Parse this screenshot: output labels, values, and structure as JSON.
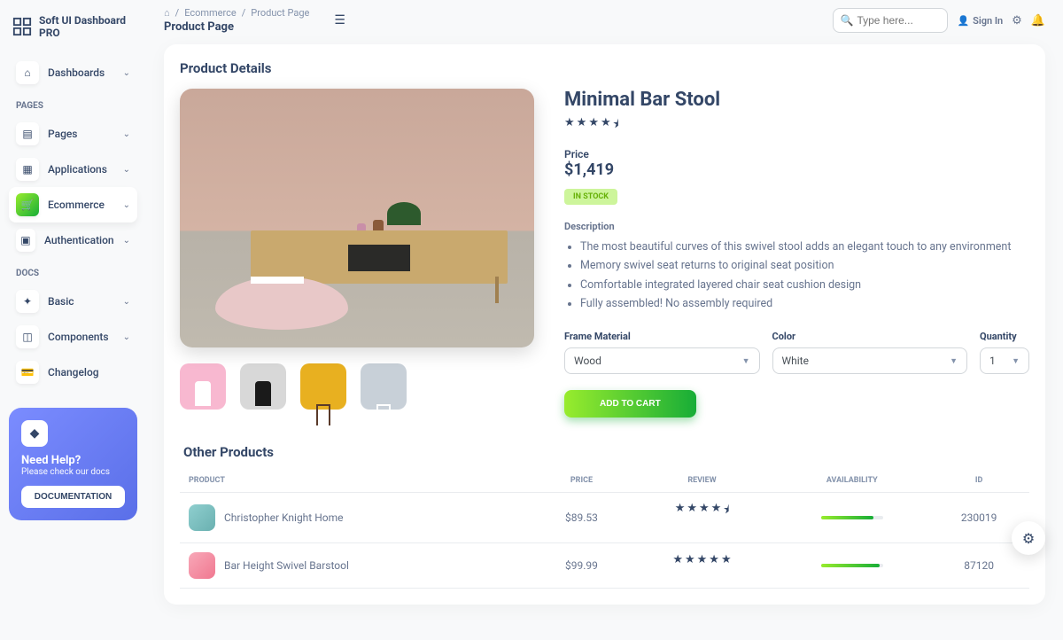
{
  "brand": "Soft UI Dashboard PRO",
  "breadcrumbs": {
    "home": "⌂",
    "l1": "Ecommerce",
    "l2": "Product Page"
  },
  "page_title": "Product Page",
  "search": {
    "placeholder": "Type here..."
  },
  "signin": "Sign In",
  "nav": {
    "dashboards": "Dashboards",
    "pages_section": "PAGES",
    "pages": "Pages",
    "applications": "Applications",
    "ecommerce": "Ecommerce",
    "authentication": "Authentication",
    "docs_section": "DOCS",
    "basic": "Basic",
    "components": "Components",
    "changelog": "Changelog"
  },
  "help": {
    "title": "Need Help?",
    "sub": "Please check our docs",
    "btn": "DOCUMENTATION"
  },
  "product": {
    "section": "Product Details",
    "name": "Minimal Bar Stool",
    "rating": 4.5,
    "price_label": "Price",
    "price": "$1,419",
    "stock": "IN STOCK",
    "desc_label": "Description",
    "features": [
      "The most beautiful curves of this swivel stool adds an elegant touch to any environment",
      "Memory swivel seat returns to original seat position",
      "Comfortable integrated layered chair seat cushion design",
      "Fully assembled! No assembly required"
    ],
    "material_label": "Frame Material",
    "material": "Wood",
    "color_label": "Color",
    "color": "White",
    "qty_label": "Quantity",
    "qty": "1",
    "add": "ADD TO CART"
  },
  "other": {
    "title": "Other Products",
    "cols": {
      "product": "Product",
      "price": "Price",
      "review": "Review",
      "availability": "Availability",
      "id": "ID"
    },
    "rows": [
      {
        "name": "Christopher Knight Home",
        "price": "$89.53",
        "rating": 4.5,
        "avail": 85,
        "id": "230019"
      },
      {
        "name": "Bar Height Swivel Barstool",
        "price": "$99.99",
        "rating": 5,
        "avail": 95,
        "id": "87120"
      }
    ]
  }
}
